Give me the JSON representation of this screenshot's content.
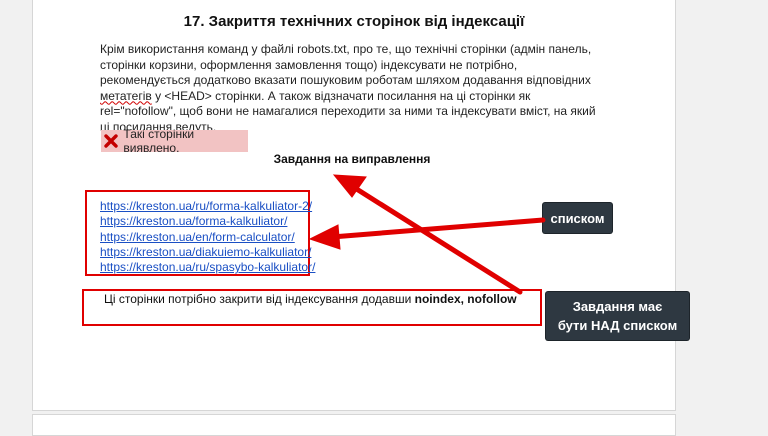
{
  "document": {
    "title": "17. Закриття технічних сторінок від індексації",
    "paragraph_before": "Крім використання команд у файлі robots.txt, про те, що технічні сторінки (адмін панель, сторінки корзини, оформлення замовлення тощо) індексувати не потрібно, рекомендується додатково вказати пошуковим роботам шляхом додавання відповідних ",
    "paragraph_underlined": "метатегів",
    "paragraph_after": " у <HEAD> сторінки. А також відзначати посилання на ці сторінки як rel=\"nofollow\", щоб вони не намагалися переходити за ними та індексувати вміст, на який ці посилання ведуть.",
    "found_label": "Такі сторінки виявлено.",
    "task_heading": "Завдання на виправлення",
    "links": [
      "https://kreston.ua/ru/forma-kalkuliator-2/",
      "https://kreston.ua/forma-kalkuliator/",
      "https://kreston.ua/en/form-calculator/",
      "https://kreston.ua/diakuiemo-kalkuliator/",
      "https://kreston.ua/ru/spasybo-kalkuliator/"
    ],
    "note_text": "Ці сторінки потрібно закрити від індексування додавши ",
    "note_bold": "noindex, nofollow"
  },
  "annotations": {
    "callout_list": "списком",
    "callout_task_line1": "Завдання має",
    "callout_task_line2": "бути НАД списком"
  },
  "colors": {
    "annotation_red": "#e00000",
    "callout_bg": "#2e3841",
    "found_bg": "#f2c3c3",
    "link": "#1a4fc4"
  }
}
